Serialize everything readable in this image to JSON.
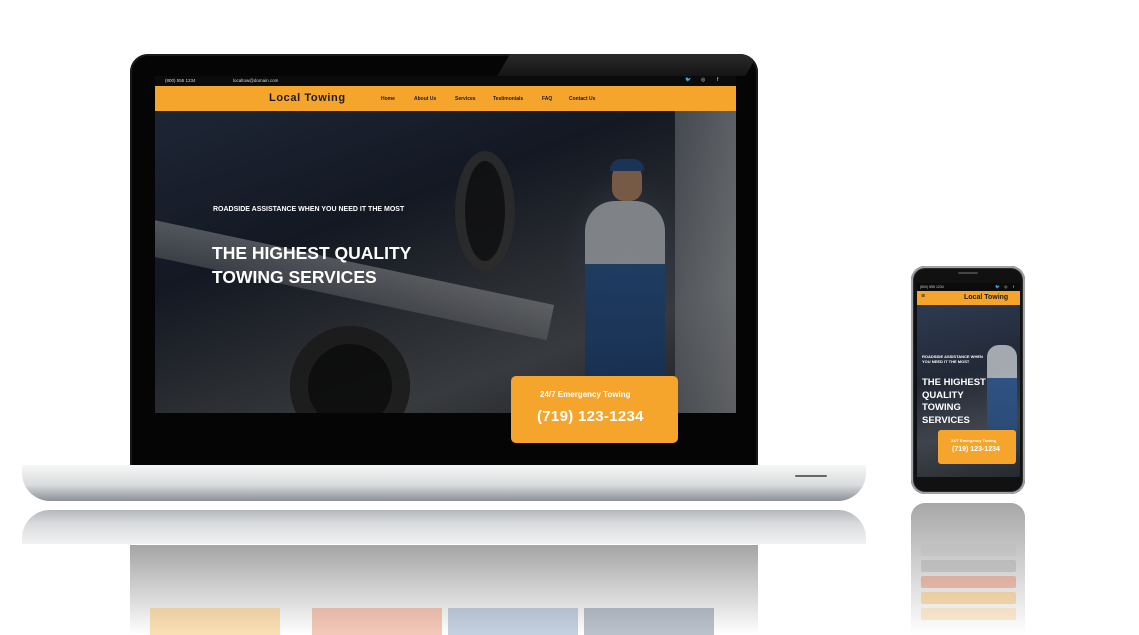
{
  "site": {
    "topbar": {
      "phone": "(800) 555 1234",
      "email": "localtow@domain.com",
      "social_icons": [
        "twitter-icon",
        "instagram-icon",
        "facebook-icon"
      ]
    },
    "logo": "Local Towing",
    "nav": [
      "Home",
      "About Us",
      "Services",
      "Testimonials",
      "FAQ",
      "Contact Us"
    ],
    "hero": {
      "subtitle": "ROADSIDE ASSISTANCE WHEN YOU NEED IT THE MOST",
      "title_line1": "THE HIGHEST QUALITY",
      "title_line2": "TOWING SERVICES"
    },
    "cta": {
      "label": "24/7 Emergency Towing",
      "phone": "(719) 123-1234"
    }
  },
  "mobile": {
    "topbar_phone": "(800) 555 1234",
    "logo": "Local Towing",
    "menu_icon": "hamburger-icon",
    "hero": {
      "subtitle": "ROADSIDE ASSISTANCE WHEN YOU NEED IT THE MOST",
      "title_line1": "THE HIGHEST",
      "title_line2": "QUALITY",
      "title_line3": "TOWING",
      "title_line4": "SERVICES"
    },
    "cta": {
      "label": "24/7 Emergency Towing",
      "phone": "(719) 123-1234"
    }
  },
  "colors": {
    "brand_orange": "#f6a52c",
    "dark": "#0b0b0b",
    "text_dark": "#1b1b1b",
    "white": "#ffffff"
  }
}
